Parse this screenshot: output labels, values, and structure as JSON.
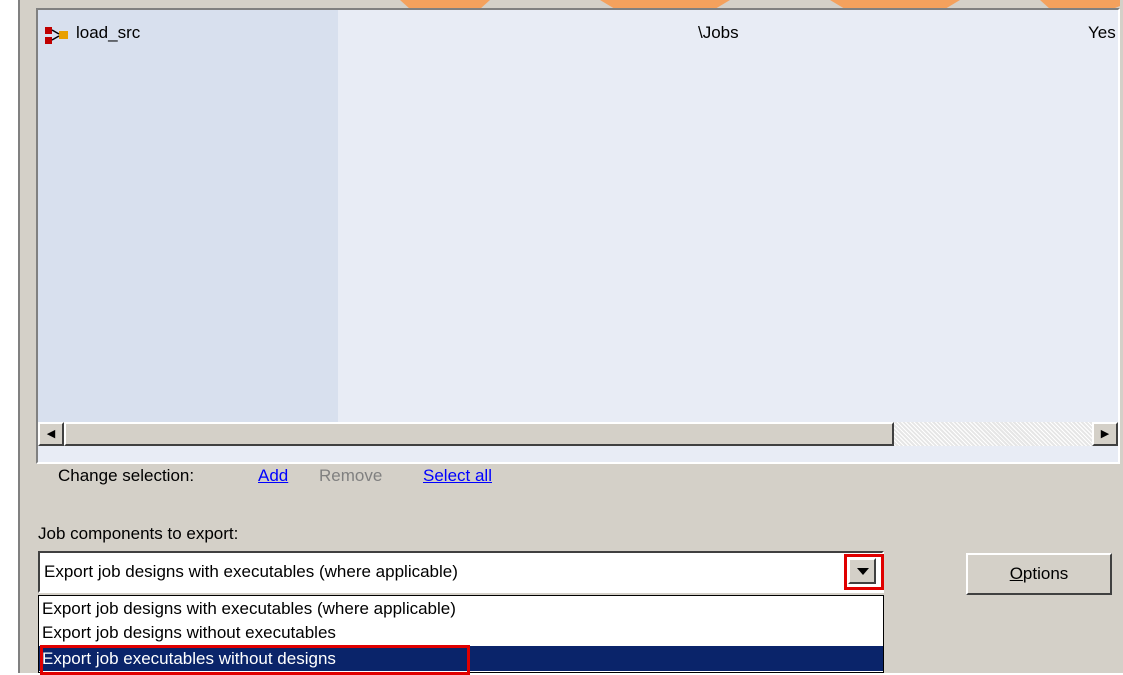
{
  "list": {
    "rows": [
      {
        "name": "load_src",
        "type": "\\Jobs",
        "executable": "Yes",
        "icon": "job-icon"
      }
    ]
  },
  "selection": {
    "label": "Change selection:",
    "add": "Add",
    "remove": "Remove",
    "select_all": "Select all"
  },
  "export": {
    "label": "Job components to export:",
    "current_value": "Export job designs with executables (where applicable)",
    "options": [
      "Export job designs with executables (where applicable)",
      "Export job designs without executables",
      "Export job executables without designs"
    ],
    "highlighted_index": 2,
    "options_button": {
      "mnemonic": "O",
      "rest": "ptions"
    }
  },
  "colors": {
    "accent_orange": "#f4a15d",
    "highlight_red": "#e00000",
    "selection_blue": "#0a246a"
  }
}
